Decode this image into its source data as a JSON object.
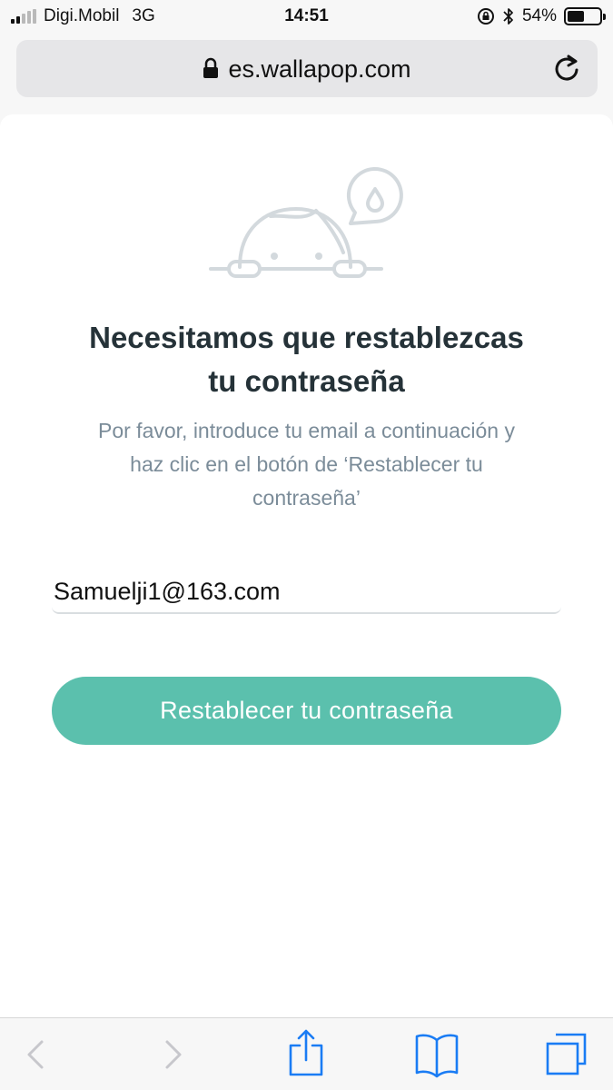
{
  "status_bar": {
    "carrier": "Digi.Mobil",
    "network": "3G",
    "time": "14:51",
    "battery": "54%",
    "battery_level": 0.54
  },
  "browser": {
    "url": "es.wallapop.com"
  },
  "reset": {
    "title_line1": "Necesitamos que restablezcas",
    "title_line2": "tu contraseña",
    "subtitle_line1": "Por favor, introduce tu email a continuación y",
    "subtitle_line2": "haz clic en el botón de ‘Restablecer tu",
    "subtitle_line3": "contraseña’",
    "email_value": "Samuelji1@163.com",
    "button_label": "Restablecer tu contraseña"
  },
  "colors": {
    "accent": "#5bc0ad",
    "title": "#253238",
    "subtitle": "#7b8c99",
    "ios_blue": "#1a7cf4"
  },
  "icons": [
    "lock-icon",
    "reload-icon",
    "turtle-illustration",
    "back-icon",
    "forward-icon",
    "share-icon",
    "bookmarks-icon",
    "tabs-icon"
  ]
}
